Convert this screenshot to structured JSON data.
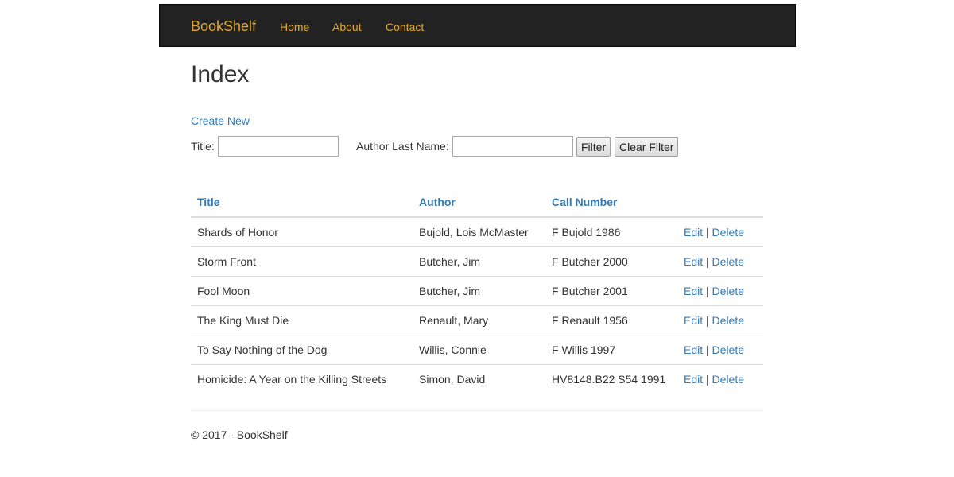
{
  "nav": {
    "brand": "BookShelf",
    "links": [
      "Home",
      "About",
      "Contact"
    ]
  },
  "page": {
    "title": "Index",
    "create_new": "Create New"
  },
  "filter": {
    "title_label": "Title:",
    "title_value": "",
    "author_label": "Author Last Name:",
    "author_value": "",
    "filter_button": "Filter",
    "clear_button": "Clear Filter"
  },
  "table": {
    "headers": [
      "Title",
      "Author",
      "Call Number"
    ],
    "rows": [
      {
        "title": "Shards of Honor",
        "author": "Bujold, Lois McMaster",
        "call_number": "F Bujold 1986"
      },
      {
        "title": "Storm Front",
        "author": "Butcher, Jim",
        "call_number": "F Butcher 2000"
      },
      {
        "title": "Fool Moon",
        "author": "Butcher, Jim",
        "call_number": "F Butcher 2001"
      },
      {
        "title": "The King Must Die",
        "author": "Renault, Mary",
        "call_number": "F Renault 1956"
      },
      {
        "title": "To Say Nothing of the Dog",
        "author": "Willis, Connie",
        "call_number": "F Willis 1997"
      },
      {
        "title": "Homicide: A Year on the Killing Streets",
        "author": "Simon, David",
        "call_number": "HV8148.B22 S54 1991"
      }
    ],
    "edit_label": "Edit",
    "separator": "|",
    "delete_label": "Delete"
  },
  "footer": {
    "text": "© 2017 - BookShelf"
  },
  "colors": {
    "navbar_bg": "#222222",
    "nav_link": "#e0a830",
    "link": "#337ab7"
  }
}
